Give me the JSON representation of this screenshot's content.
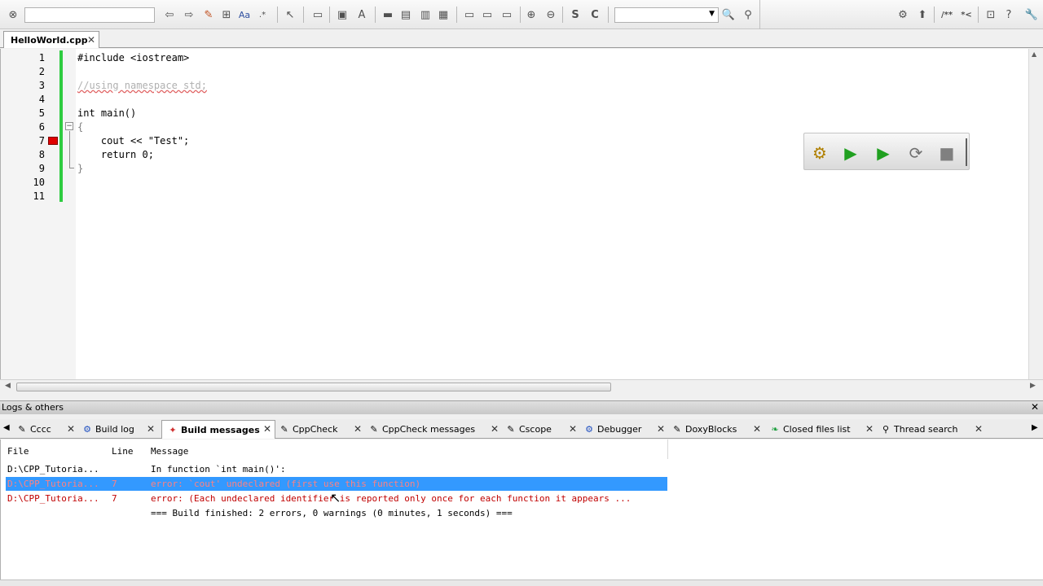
{
  "toolbar": {
    "search_value": "",
    "search2_value": ""
  },
  "editor": {
    "tab_label": "HelloWorld.cpp",
    "tab_close": "✕",
    "lines": [
      {
        "num": "1",
        "text": "#include <iostream>"
      },
      {
        "num": "2",
        "text": ""
      },
      {
        "num": "3",
        "text": "//using namespace std;"
      },
      {
        "num": "4",
        "text": ""
      },
      {
        "num": "5",
        "text": "int main()"
      },
      {
        "num": "6",
        "text": "{"
      },
      {
        "num": "7",
        "text": "    cout << \"Test\";"
      },
      {
        "num": "8",
        "text": "    return 0;"
      },
      {
        "num": "9",
        "text": "}"
      },
      {
        "num": "10",
        "text": ""
      },
      {
        "num": "11",
        "text": ""
      }
    ]
  },
  "logs": {
    "header": "Logs & others",
    "close": "✕",
    "tabs": [
      {
        "label": "Cccc",
        "icon": "pencil-icon"
      },
      {
        "label": "Build log",
        "icon": "gear-icon"
      },
      {
        "label": "Build messages",
        "icon": "pin-icon",
        "active": true
      },
      {
        "label": "CppCheck",
        "icon": "pencil-icon"
      },
      {
        "label": "CppCheck messages",
        "icon": "pencil-icon"
      },
      {
        "label": "Cscope",
        "icon": "pencil-icon"
      },
      {
        "label": "Debugger",
        "icon": "gear-icon"
      },
      {
        "label": "DoxyBlocks",
        "icon": "pencil-icon"
      },
      {
        "label": "Closed files list",
        "icon": "leaf-icon"
      },
      {
        "label": "Thread search",
        "icon": "search-icon"
      }
    ],
    "columns": {
      "file": "File",
      "line": "Line",
      "message": "Message"
    },
    "rows": [
      {
        "file": "D:\\CPP_Tutoria...",
        "line": "",
        "message": "In function `int main()':",
        "type": "info"
      },
      {
        "file": "D:\\CPP_Tutoria...",
        "line": "7",
        "message": "error: `cout' undeclared (first use this function)",
        "type": "error-selected"
      },
      {
        "file": "D:\\CPP_Tutoria...",
        "line": "7",
        "message": "error: (Each undeclared identifier is reported only once for each function it appears ...",
        "type": "error"
      },
      {
        "file": "",
        "line": "",
        "message": "=== Build finished: 2 errors, 0 warnings (0 minutes, 1 seconds) ===",
        "type": "info"
      }
    ]
  },
  "colors": {
    "change_bar": "#2ecc40",
    "selection": "#3399ff",
    "error_text": "#c00000",
    "breakpoint": "#e00000"
  }
}
